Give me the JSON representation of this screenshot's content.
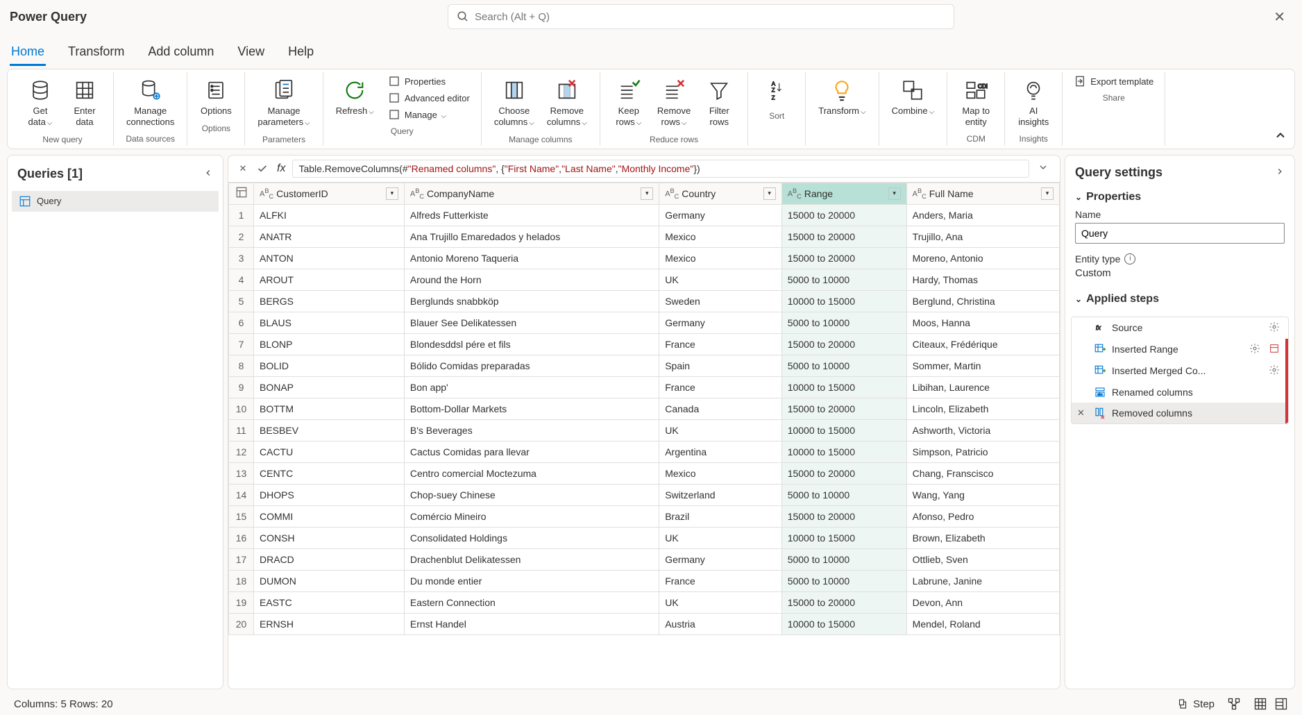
{
  "app_title": "Power Query",
  "search_placeholder": "Search (Alt + Q)",
  "menu_tabs": [
    "Home",
    "Transform",
    "Add column",
    "View",
    "Help"
  ],
  "active_tab": 0,
  "ribbon": {
    "groups": [
      {
        "label": "New query",
        "buttons": [
          "Get\ndata",
          "Enter\ndata"
        ],
        "dropdowns": [
          true,
          false
        ]
      },
      {
        "label": "Data sources",
        "buttons": [
          "Manage\nconnections"
        ],
        "dropdowns": [
          false
        ]
      },
      {
        "label": "Options",
        "buttons": [
          "Options"
        ],
        "dropdowns": [
          false
        ]
      },
      {
        "label": "Parameters",
        "buttons": [
          "Manage\nparameters"
        ],
        "dropdowns": [
          true
        ]
      },
      {
        "label": "Query",
        "buttons": [
          "Refresh"
        ],
        "dropdowns": [
          true
        ],
        "stack": [
          "Properties",
          "Advanced editor",
          "Manage"
        ]
      },
      {
        "label": "Manage columns",
        "buttons": [
          "Choose\ncolumns",
          "Remove\ncolumns"
        ],
        "dropdowns": [
          true,
          true
        ]
      },
      {
        "label": "Reduce rows",
        "buttons": [
          "Keep\nrows",
          "Remove\nrows",
          "Filter\nrows"
        ],
        "dropdowns": [
          true,
          true,
          false
        ]
      },
      {
        "label": "Sort",
        "buttons": [
          ""
        ]
      },
      {
        "label": "",
        "buttons": [
          "Transform"
        ],
        "dropdowns": [
          true
        ]
      },
      {
        "label": "",
        "buttons": [
          "Combine"
        ],
        "dropdowns": [
          true
        ]
      },
      {
        "label": "CDM",
        "buttons": [
          "Map to\nentity"
        ],
        "dropdowns": [
          false
        ]
      },
      {
        "label": "Insights",
        "buttons": [
          "AI\ninsights"
        ],
        "dropdowns": [
          false
        ]
      },
      {
        "label": "Share",
        "buttons": [],
        "stack_h": [
          "Export template"
        ]
      }
    ]
  },
  "queries": {
    "title": "Queries [1]",
    "items": [
      "Query"
    ]
  },
  "formula": {
    "prefix": "Table.RemoveColumns(#",
    "q1": "\"Renamed columns\"",
    "mid1": ", {",
    "q2": "\"First Name\"",
    "mid2": ", ",
    "q3": "\"Last Name\"",
    "mid3": ", ",
    "q4": "\"Monthly Income\"",
    "suffix": "})"
  },
  "table": {
    "columns": [
      "CustomerID",
      "CompanyName",
      "Country",
      "Range",
      "Full Name"
    ],
    "selected_col": 3,
    "rows": [
      [
        "ALFKI",
        "Alfreds Futterkiste",
        "Germany",
        "15000 to 20000",
        "Anders, Maria"
      ],
      [
        "ANATR",
        "Ana Trujillo Emaredados y helados",
        "Mexico",
        "15000 to 20000",
        "Trujillo, Ana"
      ],
      [
        "ANTON",
        "Antonio Moreno Taqueria",
        "Mexico",
        "15000 to 20000",
        "Moreno, Antonio"
      ],
      [
        "AROUT",
        "Around the Horn",
        "UK",
        "5000 to 10000",
        "Hardy, Thomas"
      ],
      [
        "BERGS",
        "Berglunds snabbköp",
        "Sweden",
        "10000 to 15000",
        "Berglund, Christina"
      ],
      [
        "BLAUS",
        "Blauer See Delikatessen",
        "Germany",
        "5000 to 10000",
        "Moos, Hanna"
      ],
      [
        "BLONP",
        "Blondesddsl pére et fils",
        "France",
        "15000 to 20000",
        "Citeaux, Frédérique"
      ],
      [
        "BOLID",
        "Bólido Comidas preparadas",
        "Spain",
        "5000 to 10000",
        "Sommer, Martin"
      ],
      [
        "BONAP",
        "Bon app'",
        "France",
        "10000 to 15000",
        "Libihan, Laurence"
      ],
      [
        "BOTTM",
        "Bottom-Dollar Markets",
        "Canada",
        "15000 to 20000",
        "Lincoln, Elizabeth"
      ],
      [
        "BESBEV",
        "B's Beverages",
        "UK",
        "10000 to 15000",
        "Ashworth, Victoria"
      ],
      [
        "CACTU",
        "Cactus Comidas para llevar",
        "Argentina",
        "10000 to 15000",
        "Simpson, Patricio"
      ],
      [
        "CENTC",
        "Centro comercial Moctezuma",
        "Mexico",
        "15000 to 20000",
        "Chang, Franscisco"
      ],
      [
        "DHOPS",
        "Chop-suey Chinese",
        "Switzerland",
        "5000 to 10000",
        "Wang, Yang"
      ],
      [
        "COMMI",
        "Comércio Mineiro",
        "Brazil",
        "15000 to 20000",
        "Afonso, Pedro"
      ],
      [
        "CONSH",
        "Consolidated Holdings",
        "UK",
        "10000 to 15000",
        "Brown, Elizabeth"
      ],
      [
        "DRACD",
        "Drachenblut Delikatessen",
        "Germany",
        "5000 to 10000",
        "Ottlieb, Sven"
      ],
      [
        "DUMON",
        "Du monde entier",
        "France",
        "5000 to 10000",
        "Labrune, Janine"
      ],
      [
        "EASTC",
        "Eastern Connection",
        "UK",
        "15000 to 20000",
        "Devon, Ann"
      ],
      [
        "ERNSH",
        "Ernst Handel",
        "Austria",
        "10000 to 15000",
        "Mendel, Roland"
      ]
    ]
  },
  "settings": {
    "title": "Query settings",
    "properties_label": "Properties",
    "name_label": "Name",
    "name_value": "Query",
    "entity_type_label": "Entity type",
    "entity_type_value": "Custom",
    "applied_steps_label": "Applied steps",
    "steps": [
      {
        "label": "Source",
        "gear": true,
        "mod": false
      },
      {
        "label": "Inserted Range",
        "gear": true,
        "mod": true
      },
      {
        "label": "Inserted Merged Co...",
        "gear": true,
        "mod": true
      },
      {
        "label": "Renamed columns",
        "gear": false,
        "mod": true
      },
      {
        "label": "Removed columns",
        "gear": false,
        "mod": true
      }
    ],
    "selected_step": 4
  },
  "status": {
    "left": "Columns: 5   Rows: 20",
    "step_label": "Step"
  }
}
